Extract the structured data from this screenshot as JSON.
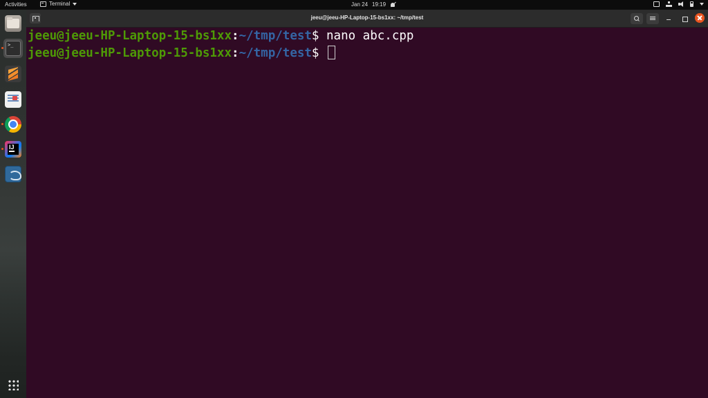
{
  "topbar": {
    "activities": "Activities",
    "app_menu_label": "Terminal",
    "date": "Jan 24",
    "time": "19:19"
  },
  "dock": {
    "items": [
      "files",
      "terminal",
      "sublime-text",
      "text-editor",
      "chrome",
      "intellij",
      "mysql-workbench"
    ],
    "show_apps": "show-apps-grid"
  },
  "window": {
    "title": "jeeu@jeeu-HP-Laptop-15-bs1xx: ~/tmp/test"
  },
  "terminal": {
    "lines": [
      {
        "user": "jeeu@jeeu-HP-Laptop-15-bs1xx",
        "sep": ":",
        "path": "~/tmp/test",
        "prompt": "$ ",
        "command": "nano abc.cpp"
      },
      {
        "user": "jeeu@jeeu-HP-Laptop-15-bs1xx",
        "sep": ":",
        "path": "~/tmp/test",
        "prompt": "$ ",
        "command": ""
      }
    ]
  },
  "colors": {
    "terminal_bg": "#300a24",
    "user_host": "#4e9a06",
    "path": "#3465a4",
    "close_button": "#e95420"
  }
}
